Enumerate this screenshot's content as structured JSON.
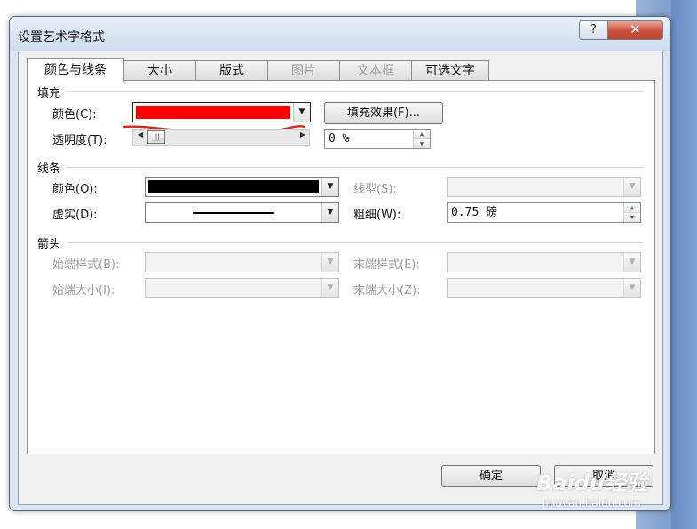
{
  "dialog": {
    "title": "设置艺术字格式",
    "help_label": "?",
    "close_label": "✕"
  },
  "tabs": [
    {
      "label": "颜色与线条",
      "active": true,
      "enabled": true
    },
    {
      "label": "大小",
      "active": false,
      "enabled": true
    },
    {
      "label": "版式",
      "active": false,
      "enabled": true
    },
    {
      "label": "图片",
      "active": false,
      "enabled": false
    },
    {
      "label": "文本框",
      "active": false,
      "enabled": false
    },
    {
      "label": "可选文字",
      "active": false,
      "enabled": true
    }
  ],
  "fill": {
    "section_label": "填充",
    "color_label": "颜色(C):",
    "color_value": "#ff0000",
    "effects_button": "填充效果(F)...",
    "transparency_label": "透明度(T):",
    "transparency_value": "0 %",
    "transparency_level": 0
  },
  "line": {
    "section_label": "线条",
    "color_label": "颜色(O):",
    "color_value": "#000000",
    "style_label": "线型(S):",
    "dash_label": "虚实(D):",
    "weight_label": "粗细(W):",
    "weight_value": "0.75 磅"
  },
  "arrows": {
    "section_label": "箭头",
    "begin_style_label": "始端样式(B):",
    "end_style_label": "末端样式(E):",
    "begin_size_label": "始端大小(I):",
    "end_size_label": "末端大小(Z):"
  },
  "buttons": {
    "ok_label": "确定",
    "cancel_label": "取消"
  },
  "watermark": {
    "brand": "Baidu经验",
    "url": "jingyan.baidu.com"
  },
  "colors": {
    "annotation": "#e0201a",
    "title_bar": "#dbe5f1",
    "close_button": "#c9503a"
  }
}
